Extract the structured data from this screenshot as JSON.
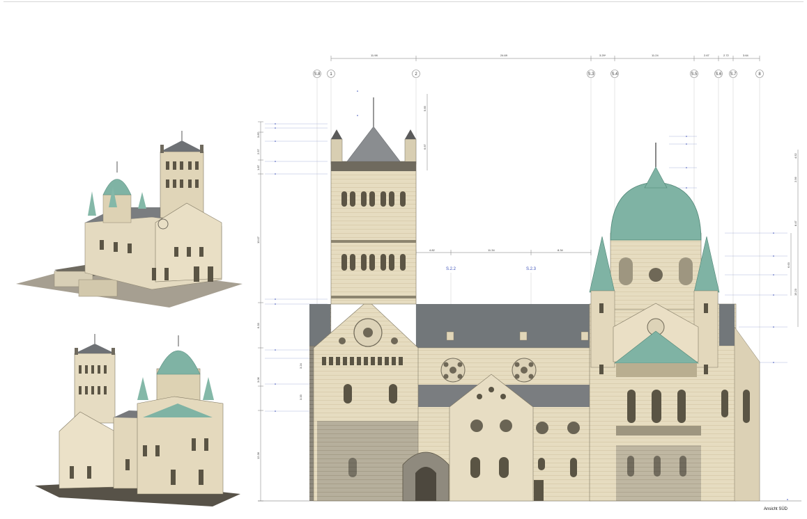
{
  "drawing": {
    "view_title": "Ansicht SÜD",
    "top_dimensions": [
      "11.98",
      "24.69",
      "3.29*",
      "11.24",
      "2.67",
      "2.72",
      "3.64"
    ],
    "axis_labels": [
      "S.8",
      "1",
      "2",
      "S.3",
      "S.4",
      "S.5",
      "S.6",
      "S.7",
      "8"
    ],
    "nave_dimensions": [
      "4.82",
      "11.34",
      "8.34"
    ],
    "section_labels": [
      "S.2.2",
      "S.2.3"
    ],
    "left_vertical_dimensions": [
      "3.87",
      "2.57",
      "1.87",
      "10.07",
      "6.33",
      "3.24",
      "3.06",
      "3.33",
      "12.36"
    ],
    "right_vertical_dimensions": [
      "4.52",
      "2.56",
      "8.47",
      "6.63",
      "15.23"
    ],
    "tower_vertical_dimensions": [
      "5.65",
      "6.67"
    ]
  },
  "colors": {
    "stone": "#e6dcc0",
    "stone_shade": "#c7b996",
    "roof": "#72777a",
    "copper": "#7fb3a4",
    "annotation": "#3b4fb8"
  }
}
